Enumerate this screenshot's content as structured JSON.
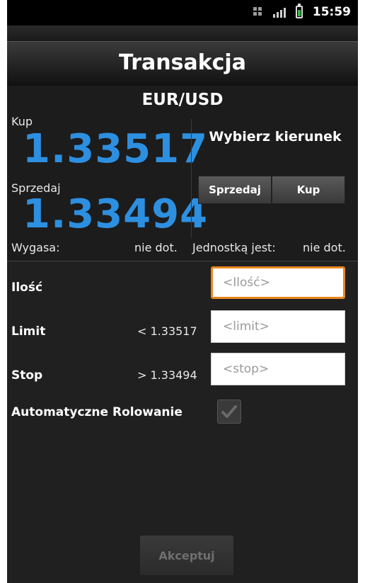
{
  "status": {
    "time": "15:59"
  },
  "header": {
    "title": "Transakcja"
  },
  "quote": {
    "pair": "EUR/USD",
    "buy_label": "Kup",
    "buy_price": "1.33517",
    "sell_label": "Sprzedaj",
    "sell_price": "1.33494",
    "expires_label": "Wygasa:",
    "expires_value": "nie dot.",
    "unit_label": "Jednostką jest:",
    "unit_value": "nie dot."
  },
  "direction": {
    "title": "Wybierz kierunek",
    "sell_button": "Sprzedaj",
    "buy_button": "Kup"
  },
  "form": {
    "quantity_label": "Ilość",
    "quantity_placeholder": "<Ilość>",
    "limit_label": "Limit",
    "limit_hint": "< 1.33517",
    "limit_placeholder": "<limit>",
    "stop_label": "Stop",
    "stop_hint": "> 1.33494",
    "stop_placeholder": "<stop>",
    "auto_roll_label": "Automatyczne Rolowanie",
    "auto_roll_checked": true
  },
  "accept_button": "Akceptuj"
}
